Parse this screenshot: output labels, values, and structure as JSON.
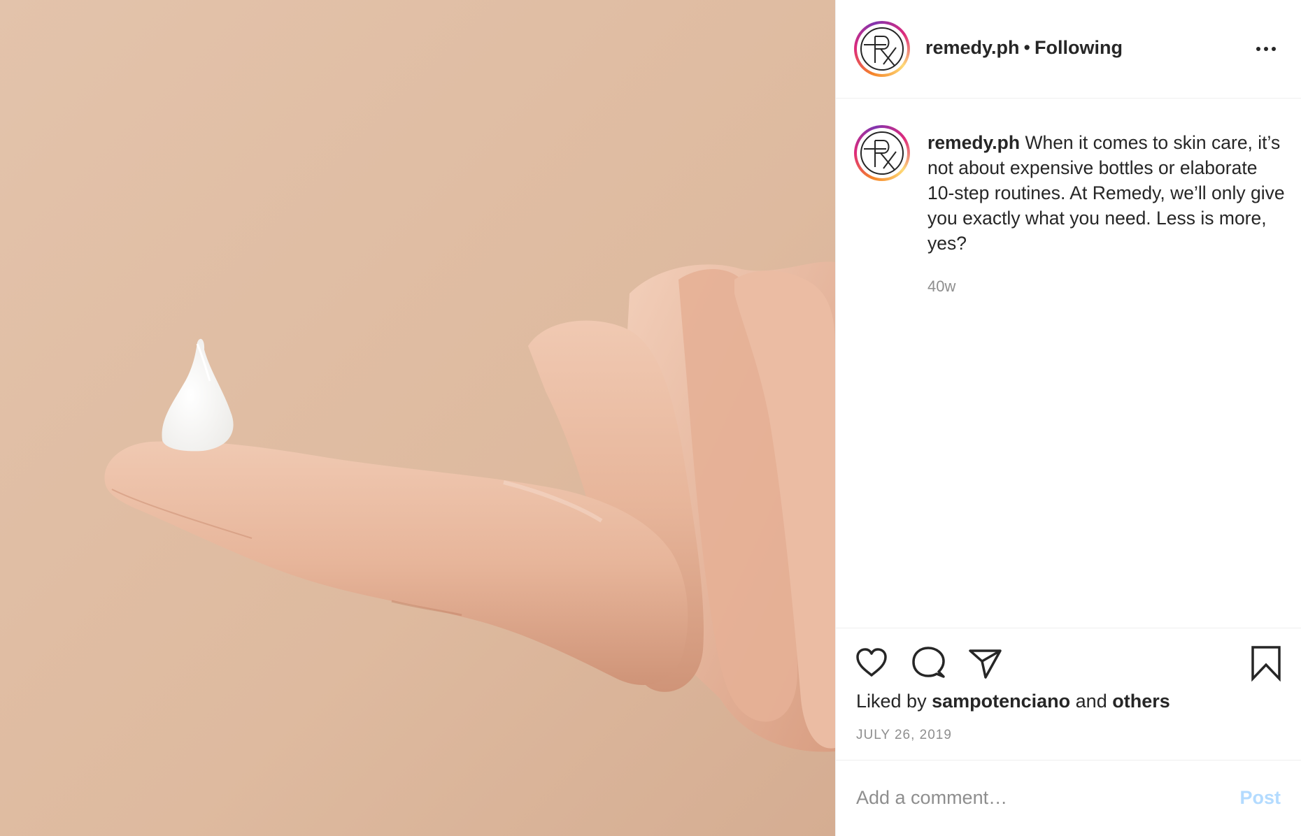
{
  "post": {
    "image_alt": "Hand with a dollop of white cream on the fingertip",
    "account": {
      "username": "remedy.ph",
      "separator": "•",
      "follow_status": "Following",
      "avatar_icon": "rx-logo-icon"
    },
    "caption": {
      "username": "remedy.ph",
      "text": "When it comes to skin care, it’s not about expensive bottles or elaborate 10-step routines. At Remedy, we’ll only give you exactly what you need. Less is more, yes?",
      "age": "40w"
    },
    "actions": {
      "like_icon": "heart-icon",
      "comment_icon": "comment-bubble-icon",
      "share_icon": "paper-plane-icon",
      "save_icon": "bookmark-icon"
    },
    "likes": {
      "prefix": "Liked by",
      "user": "sampotenciano",
      "conjunction": "and",
      "others": "others"
    },
    "date": "JULY 26, 2019",
    "comment": {
      "placeholder": "Add a comment…",
      "post_label": "Post"
    },
    "colors": {
      "background_skin": "#e1bfa6",
      "post_button_disabled": "#b3dbff",
      "muted_text": "#8e8e8e",
      "text": "#262626"
    }
  }
}
